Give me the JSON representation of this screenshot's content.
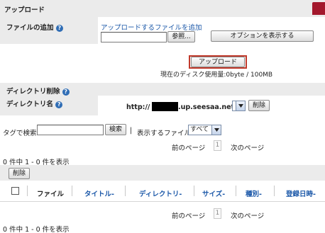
{
  "upload_section": {
    "title": "アップロード",
    "add_file_label": "ファイルの追加",
    "add_file_link": "アップロードするファイルを追加",
    "browse_button": "参照...",
    "options_button": "オプションを表示する",
    "upload_button": "アップロード",
    "disk_usage": "現在のディスク使用量:0byte / 100MB"
  },
  "directory_section": {
    "title": "ディレクトリ削除",
    "dir_name_label": "ディレクトリ名",
    "url_prefix": "http://",
    "url_suffix": ".up.seesaa.net/",
    "delete_button": "削除"
  },
  "filter": {
    "tag_search_label": "タグで検索:",
    "search_button": "検索",
    "divider": "|",
    "file_type_label": "表示するファイル",
    "file_type_selected": "すべて"
  },
  "pager": {
    "prev": "前のページ",
    "page": "1",
    "next": "次のページ"
  },
  "counts": {
    "top": "0 件中 1 - 0 件を表示",
    "bottom": "0 件中 1 - 0 件を表示"
  },
  "table": {
    "delete_button": "削除",
    "columns": [
      "ファイル",
      "タイトル",
      "ディレクトリ",
      "サイズ",
      "種別",
      "登録日時"
    ]
  },
  "colors": {
    "header_bar": "#ebebeb",
    "link": "#1a57a8",
    "upload_button_outline": "#c0392b"
  }
}
